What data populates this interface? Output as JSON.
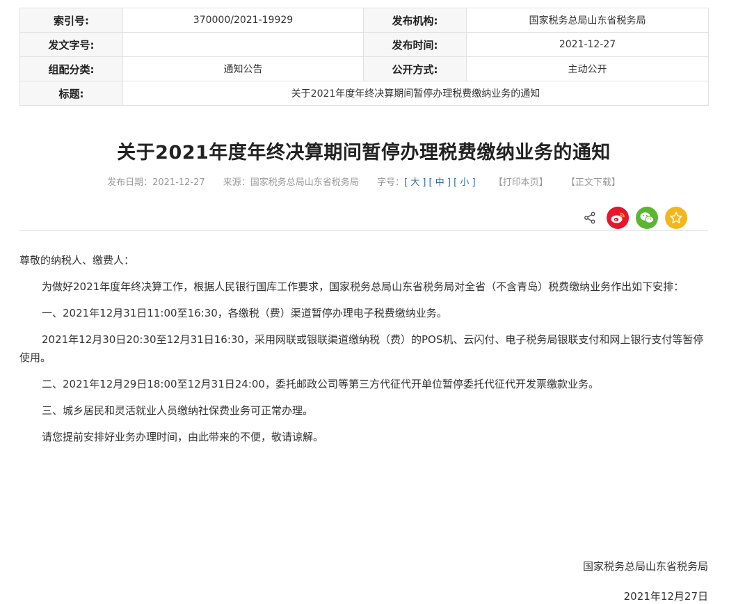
{
  "meta": {
    "index_label": "索引号:",
    "index_value": "370000/2021-19929",
    "publisher_label": "发布机构:",
    "publisher_value": "国家税务总局山东省税务局",
    "docno_label": "发文字号:",
    "docno_value": "",
    "pubtime_label": "发布时间:",
    "pubtime_value": "2021-12-27",
    "category_label": "组配分类:",
    "category_value": "通知公告",
    "openmode_label": "公开方式:",
    "openmode_value": "主动公开",
    "title_label": "标题:",
    "title_value": "关于2021年度年终决算期间暂停办理税费缴纳业务的通知"
  },
  "article": {
    "title": "关于2021年度年终决算期间暂停办理税费缴纳业务的通知",
    "date_text": "发布日期：2021-12-27",
    "source_text": "来源：国家税务总局山东省税务局",
    "fontsize_label": "字号：",
    "fs_open1": "[",
    "fs_large": "大",
    "fs_mid_open": "] [",
    "fs_medium": "中",
    "fs_small_open": "] [",
    "fs_small": "小",
    "fs_close": "]",
    "print_label": "【打印本页】",
    "download_label": "【正文下载】"
  },
  "share": {
    "icons": [
      "share-icon",
      "weibo-icon",
      "wechat-icon",
      "favorite-icon"
    ],
    "colors": {
      "weibo": "#e6162d",
      "wechat": "#5cb531",
      "favorite": "#f3b61d",
      "share": "#555555"
    }
  },
  "body": {
    "salutation": "尊敬的纳税人、缴费人：",
    "p1": "为做好2021年度年终决算工作，根据人民银行国库工作要求，国家税务总局山东省税务局对全省（不含青岛）税费缴纳业务作出如下安排：",
    "p2": "一、2021年12月31日11:00至16:30，各缴税（费）渠道暂停办理电子税费缴纳业务。",
    "p3": "2021年12月30日20:30至12月31日16:30，采用网联或银联渠道缴纳税（费）的POS机、云闪付、电子税务局银联支付和网上银行支付等暂停使用。",
    "p4": "二、2021年12月29日18:00至12月31日24:00，委托邮政公司等第三方代征代开单位暂停委托代征代开发票缴款业务。",
    "p5": "三、城乡居民和灵活就业人员缴纳社保费业务可正常办理。",
    "p6": "请您提前安排好业务办理时间，由此带来的不便，敬请谅解。",
    "signature": "国家税务总局山东省税务局",
    "sign_date": "2021年12月27日"
  }
}
